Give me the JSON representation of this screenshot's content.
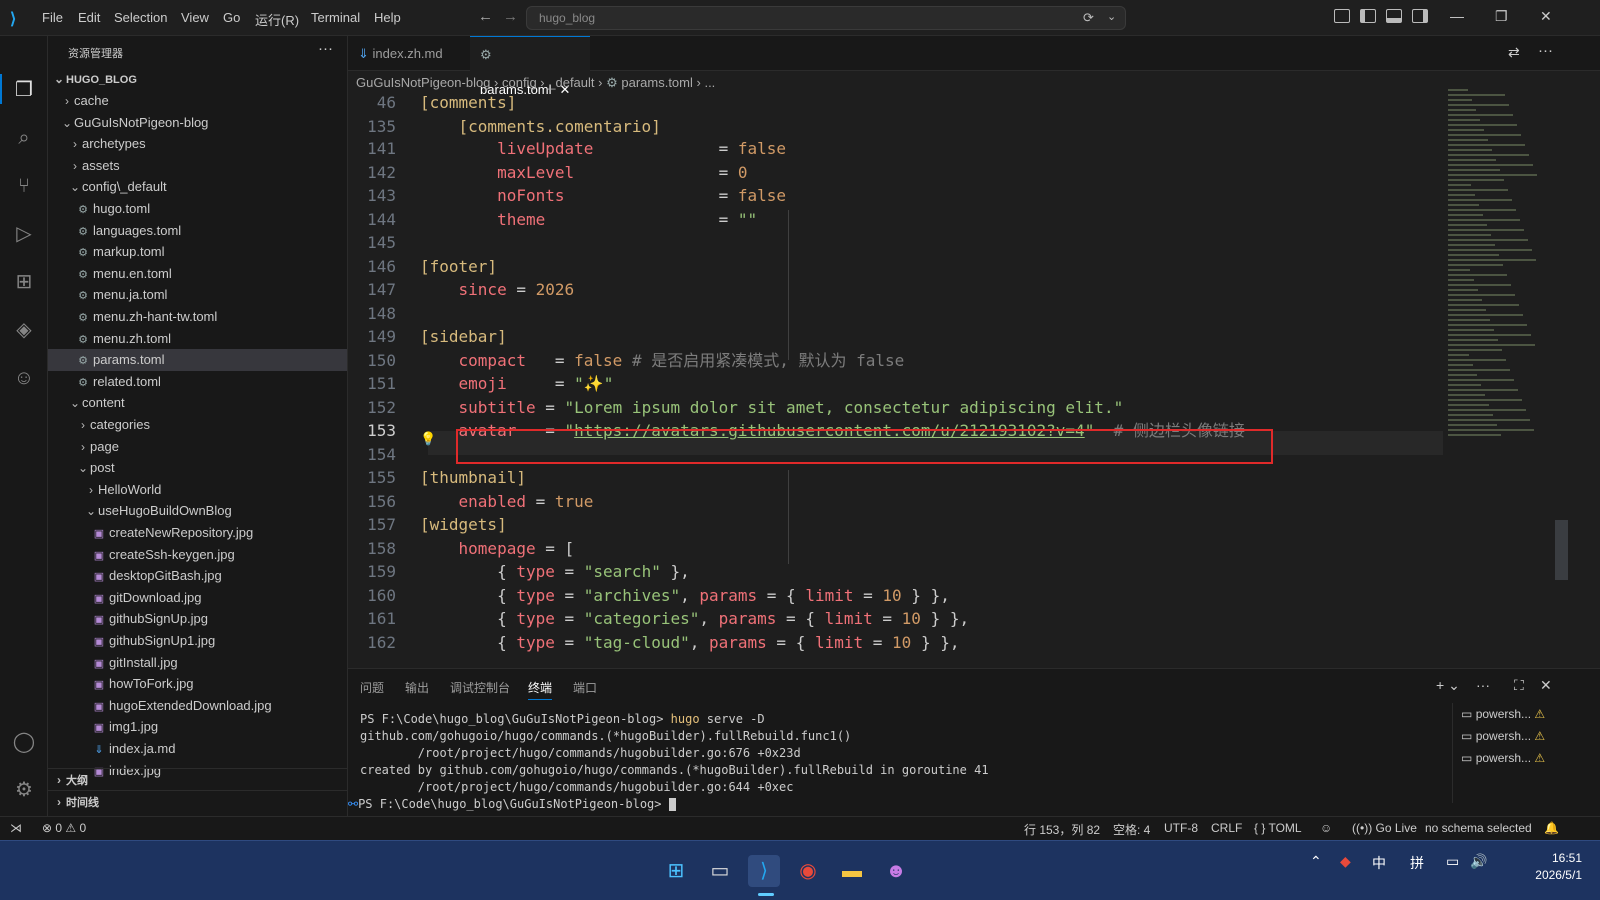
{
  "titlebar": {
    "menus": [
      "File",
      "Edit",
      "Selection",
      "View",
      "Go",
      "运行(R)",
      "Terminal",
      "Help"
    ],
    "search_text": "hugo_blog"
  },
  "sidebar": {
    "title": "资源管理器",
    "root": "HUGO_BLOG",
    "items": [
      {
        "label": "cache",
        "depth": 1,
        "kind": "folder-closed"
      },
      {
        "label": "GuGuIsNotPigeon-blog",
        "depth": 1,
        "kind": "folder-open"
      },
      {
        "label": "archetypes",
        "depth": 2,
        "kind": "folder-closed"
      },
      {
        "label": "assets",
        "depth": 2,
        "kind": "folder-closed"
      },
      {
        "label": "config\\_default",
        "depth": 2,
        "kind": "folder-open"
      },
      {
        "label": "hugo.toml",
        "depth": 3,
        "kind": "toml"
      },
      {
        "label": "languages.toml",
        "depth": 3,
        "kind": "toml"
      },
      {
        "label": "markup.toml",
        "depth": 3,
        "kind": "toml"
      },
      {
        "label": "menu.en.toml",
        "depth": 3,
        "kind": "toml"
      },
      {
        "label": "menu.ja.toml",
        "depth": 3,
        "kind": "toml"
      },
      {
        "label": "menu.zh-hant-tw.toml",
        "depth": 3,
        "kind": "toml"
      },
      {
        "label": "menu.zh.toml",
        "depth": 3,
        "kind": "toml"
      },
      {
        "label": "params.toml",
        "depth": 3,
        "kind": "toml",
        "selected": true
      },
      {
        "label": "related.toml",
        "depth": 3,
        "kind": "toml"
      },
      {
        "label": "content",
        "depth": 2,
        "kind": "folder-open"
      },
      {
        "label": "categories",
        "depth": 3,
        "kind": "folder-closed"
      },
      {
        "label": "page",
        "depth": 3,
        "kind": "folder-closed"
      },
      {
        "label": "post",
        "depth": 3,
        "kind": "folder-open"
      },
      {
        "label": "HelloWorld",
        "depth": 4,
        "kind": "folder-closed"
      },
      {
        "label": "useHugoBuildOwnBlog",
        "depth": 4,
        "kind": "folder-open"
      },
      {
        "label": "createNewRepository.jpg",
        "depth": 5,
        "kind": "img"
      },
      {
        "label": "createSsh-keygen.jpg",
        "depth": 5,
        "kind": "img"
      },
      {
        "label": "desktopGitBash.jpg",
        "depth": 5,
        "kind": "img"
      },
      {
        "label": "gitDownload.jpg",
        "depth": 5,
        "kind": "img"
      },
      {
        "label": "githubSignUp.jpg",
        "depth": 5,
        "kind": "img"
      },
      {
        "label": "githubSignUp1.jpg",
        "depth": 5,
        "kind": "img"
      },
      {
        "label": "gitInstall.jpg",
        "depth": 5,
        "kind": "img"
      },
      {
        "label": "howToFork.jpg",
        "depth": 5,
        "kind": "img"
      },
      {
        "label": "hugoExtendedDownload.jpg",
        "depth": 5,
        "kind": "img"
      },
      {
        "label": "img1.jpg",
        "depth": 5,
        "kind": "img"
      },
      {
        "label": "index.ja.md",
        "depth": 5,
        "kind": "md"
      },
      {
        "label": "index.jpg",
        "depth": 5,
        "kind": "img"
      }
    ],
    "outline": "大纲",
    "timeline": "时间线"
  },
  "tabs": [
    {
      "label": "index.zh.md",
      "icon": "markdown"
    },
    {
      "label": "params.toml",
      "icon": "gear",
      "active": true
    }
  ],
  "breadcrumb": [
    "GuGuIsNotPigeon-blog",
    "config",
    "_default",
    "params.toml",
    "..."
  ],
  "editor": {
    "sticky": [
      {
        "n": "46",
        "text": "[comments]"
      },
      {
        "n": "135",
        "text": "    [comments.comentario]"
      }
    ],
    "lines": [
      {
        "n": "141",
        "tokens": [
          [
            "key",
            "        liveUpdate"
          ],
          [
            "op",
            "             = "
          ],
          [
            "bool",
            "false"
          ]
        ]
      },
      {
        "n": "142",
        "tokens": [
          [
            "key",
            "        maxLevel"
          ],
          [
            "op",
            "               = "
          ],
          [
            "num",
            "0"
          ]
        ]
      },
      {
        "n": "143",
        "tokens": [
          [
            "key",
            "        noFonts"
          ],
          [
            "op",
            "                = "
          ],
          [
            "bool",
            "false"
          ]
        ]
      },
      {
        "n": "144",
        "tokens": [
          [
            "key",
            "        theme"
          ],
          [
            "op",
            "                  = "
          ],
          [
            "str",
            "\"\""
          ]
        ]
      },
      {
        "n": "145",
        "tokens": []
      },
      {
        "n": "146",
        "tokens": [
          [
            "bracket",
            "[footer]"
          ]
        ]
      },
      {
        "n": "147",
        "tokens": [
          [
            "key",
            "    since"
          ],
          [
            "op",
            " = "
          ],
          [
            "num",
            "2026"
          ]
        ]
      },
      {
        "n": "148",
        "tokens": []
      },
      {
        "n": "149",
        "tokens": [
          [
            "bracket",
            "[sidebar]"
          ]
        ]
      },
      {
        "n": "150",
        "tokens": [
          [
            "key",
            "    compact"
          ],
          [
            "op",
            "   = "
          ],
          [
            "bool",
            "false"
          ],
          [
            "cmt",
            " # 是否启用紧凑模式, 默认为 false"
          ]
        ]
      },
      {
        "n": "151",
        "tokens": [
          [
            "key",
            "    emoji"
          ],
          [
            "op",
            "     = "
          ],
          [
            "str",
            "\"✨\""
          ]
        ]
      },
      {
        "n": "152",
        "tokens": [
          [
            "key",
            "    subtitle"
          ],
          [
            "op",
            " = "
          ],
          [
            "str",
            "\"Lorem ipsum dolor sit amet, consectetur adipiscing elit.\""
          ]
        ]
      },
      {
        "n": "153",
        "tokens": [
          [
            "key",
            "    avatar"
          ],
          [
            "op",
            "   = "
          ],
          [
            "str",
            "\""
          ],
          [
            "url",
            "https://avatars.githubusercontent.com/u/212193102?v=4"
          ],
          [
            "str",
            "\""
          ],
          [
            "cmt",
            "  # 侧边栏头像链接"
          ]
        ],
        "current": true
      },
      {
        "n": "154",
        "tokens": []
      },
      {
        "n": "155",
        "tokens": [
          [
            "bracket",
            "[thumbnail]"
          ]
        ]
      },
      {
        "n": "156",
        "tokens": [
          [
            "key",
            "    enabled"
          ],
          [
            "op",
            " = "
          ],
          [
            "bool",
            "true"
          ]
        ]
      },
      {
        "n": "157",
        "tokens": [
          [
            "bracket",
            "[widgets]"
          ]
        ]
      },
      {
        "n": "158",
        "tokens": [
          [
            "key",
            "    homepage"
          ],
          [
            "op",
            " = ["
          ]
        ]
      },
      {
        "n": "159",
        "tokens": [
          [
            "op",
            "        { "
          ],
          [
            "key",
            "type"
          ],
          [
            "op",
            " = "
          ],
          [
            "str",
            "\"search\""
          ],
          [
            "op",
            " },"
          ]
        ]
      },
      {
        "n": "160",
        "tokens": [
          [
            "op",
            "        { "
          ],
          [
            "key",
            "type"
          ],
          [
            "op",
            " = "
          ],
          [
            "str",
            "\"archives\""
          ],
          [
            "op",
            ", "
          ],
          [
            "key",
            "params"
          ],
          [
            "op",
            " = { "
          ],
          [
            "key",
            "limit"
          ],
          [
            "op",
            " = "
          ],
          [
            "num",
            "10"
          ],
          [
            "op",
            " } },"
          ]
        ]
      },
      {
        "n": "161",
        "tokens": [
          [
            "op",
            "        { "
          ],
          [
            "key",
            "type"
          ],
          [
            "op",
            " = "
          ],
          [
            "str",
            "\"categories\""
          ],
          [
            "op",
            ", "
          ],
          [
            "key",
            "params"
          ],
          [
            "op",
            " = { "
          ],
          [
            "key",
            "limit"
          ],
          [
            "op",
            " = "
          ],
          [
            "num",
            "10"
          ],
          [
            "op",
            " } },"
          ]
        ]
      },
      {
        "n": "162",
        "tokens": [
          [
            "op",
            "        { "
          ],
          [
            "key",
            "type"
          ],
          [
            "op",
            " = "
          ],
          [
            "str",
            "\"tag-cloud\""
          ],
          [
            "op",
            ", "
          ],
          [
            "key",
            "params"
          ],
          [
            "op",
            " = { "
          ],
          [
            "key",
            "limit"
          ],
          [
            "op",
            " = "
          ],
          [
            "num",
            "10"
          ],
          [
            "op",
            " } },"
          ]
        ]
      }
    ]
  },
  "panel": {
    "tabs": [
      "问题",
      "输出",
      "调试控制台",
      "终端",
      "端口"
    ],
    "active_tab": "终端",
    "terminal": {
      "prompt1": "PS F:\\Code\\hugo_blog\\GuGuIsNotPigeon-blog> ",
      "cmd_word": "hugo",
      "cmd_rest": " serve -D",
      "out1": "github.com/gohugoio/hugo/commands.(*hugoBuilder).fullRebuild.func1()",
      "out2": "        /root/project/hugo/commands/hugobuilder.go:676 +0x23d",
      "out3": "created by github.com/gohugoio/hugo/commands.(*hugoBuilder).fullRebuild in goroutine 41",
      "out4": "        /root/project/hugo/commands/hugobuilder.go:644 +0xec",
      "prompt2": "PS F:\\Code\\hugo_blog\\GuGuIsNotPigeon-blog> "
    },
    "terminals": [
      "powersh...",
      "powersh...",
      "powersh..."
    ]
  },
  "statusbar": {
    "errors": "0",
    "warnings": "0",
    "position": "行 153，列 82",
    "spaces": "空格: 4",
    "encoding": "UTF-8",
    "eol": "CRLF",
    "language": "TOML",
    "golive": "Go Live",
    "schema": "no schema selected"
  },
  "taskbar": {
    "ime1": "中",
    "ime2": "拼",
    "time": "16:51",
    "date": "2026/5/1"
  },
  "colors": {
    "accent": "#0078d4",
    "highlight_box": "#e02a2a",
    "taskbar": "#1d3360"
  }
}
